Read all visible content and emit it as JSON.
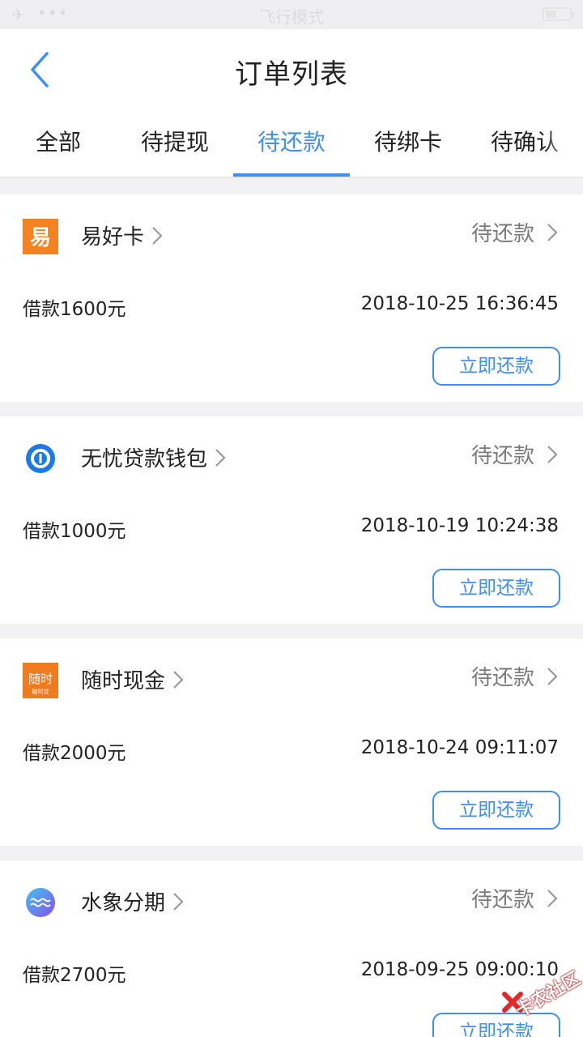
{
  "status_bar": {
    "mode_text": "飞行模式",
    "dots": "•••"
  },
  "header": {
    "title": "订单列表"
  },
  "tabs": [
    {
      "label": "全部"
    },
    {
      "label": "待提现"
    },
    {
      "label": "待还款"
    },
    {
      "label": "待绑卡"
    },
    {
      "label": "待确认"
    }
  ],
  "active_tab_index": 2,
  "orders": [
    {
      "app_name": "易好卡",
      "logo_text": "易",
      "status": "待还款",
      "amount": "借款1600元",
      "time": "2018-10-25 16:36:45",
      "action": "立即还款"
    },
    {
      "app_name": "无忧贷款钱包",
      "status": "待还款",
      "amount": "借款1000元",
      "time": "2018-10-19 10:24:38",
      "action": "立即还款"
    },
    {
      "app_name": "随时现金",
      "logo_text": "随时",
      "logo_subtext": "随时贷",
      "status": "待还款",
      "amount": "借款2000元",
      "time": "2018-10-24 09:11:07",
      "action": "立即还款"
    },
    {
      "app_name": "水象分期",
      "status": "待还款",
      "amount": "借款2700元",
      "time": "2018-09-25 09:00:10",
      "action": "立即还款"
    }
  ],
  "watermark": {
    "text": "卡农社区"
  },
  "colors": {
    "accent": "#3d8ff0",
    "orange": "#f58220",
    "background": "#f2f2f4"
  }
}
